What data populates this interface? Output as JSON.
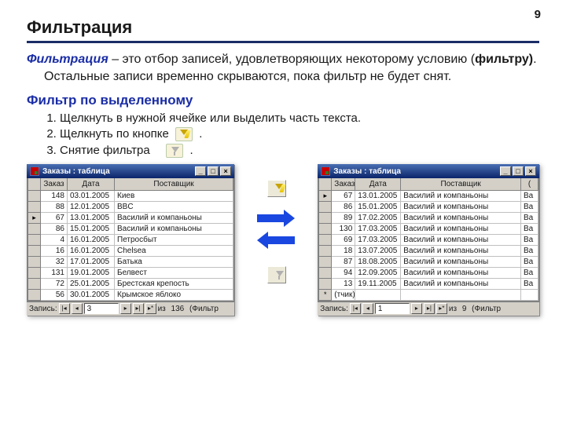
{
  "page_number": "9",
  "title": "Фильтрация",
  "definition": {
    "term": "Фильтрация",
    "dash_and_text": " – это отбор записей, удовлетворяющих некоторому условию (",
    "bold_word": "фильтру)",
    "after_bold": ".",
    "line2": "Остальные записи временно скрываются, пока фильтр не будет снят."
  },
  "selection_filter_title": "Фильтр по выделенному",
  "steps": [
    "Щелкнуть в нужной ячейке или выделить часть текста.",
    "Щелкнуть по кнопке",
    "Снятие фильтра"
  ],
  "trail_dot": ".",
  "icons": {
    "apply_filter": "filter-by-selection-icon",
    "remove_filter": "remove-filter-icon"
  },
  "window_title": "Заказы : таблица",
  "table_headers": {
    "id": "Заказ",
    "date": "Дата",
    "supplier": "Поставщик",
    "extra": "("
  },
  "record_label": "Запись:",
  "of_label": "из",
  "filter_suffix": "(Фильтр",
  "left_table": {
    "rows": [
      {
        "id": "148",
        "date": "03.01.2005",
        "supplier": "Киев"
      },
      {
        "id": "88",
        "date": "12.01.2005",
        "supplier": "BBC"
      },
      {
        "id": "67",
        "date": "13.01.2005",
        "supplier": "Василий и компаньоны",
        "marker": "▸"
      },
      {
        "id": "86",
        "date": "15.01.2005",
        "supplier": "Василий и компаньоны"
      },
      {
        "id": "4",
        "date": "16.01.2005",
        "supplier": "Петросбыт"
      },
      {
        "id": "16",
        "date": "16.01.2005",
        "supplier": "Chelsea"
      },
      {
        "id": "32",
        "date": "17.01.2005",
        "supplier": "Батька"
      },
      {
        "id": "131",
        "date": "19.01.2005",
        "supplier": "Белвест"
      },
      {
        "id": "72",
        "date": "25.01.2005",
        "supplier": "Брестская крепость"
      },
      {
        "id": "56",
        "date": "30.01.2005",
        "supplier": "Крымское яблоко"
      }
    ],
    "current": "3",
    "total": "136"
  },
  "right_table": {
    "rows": [
      {
        "id": "67",
        "date": "13.01.2005",
        "supplier": "Василий и компаньоны",
        "extra": "Ва",
        "marker": "▸"
      },
      {
        "id": "86",
        "date": "15.01.2005",
        "supplier": "Василий и компаньоны",
        "extra": "Ва"
      },
      {
        "id": "89",
        "date": "17.02.2005",
        "supplier": "Василий и компаньоны",
        "extra": "Ва"
      },
      {
        "id": "130",
        "date": "17.03.2005",
        "supplier": "Василий и компаньоны",
        "extra": "Ва"
      },
      {
        "id": "69",
        "date": "17.03.2005",
        "supplier": "Василий и компаньоны",
        "extra": "Ва"
      },
      {
        "id": "18",
        "date": "13.07.2005",
        "supplier": "Василий и компаньоны",
        "extra": "Ва"
      },
      {
        "id": "87",
        "date": "18.08.2005",
        "supplier": "Василий и компаньоны",
        "extra": "Ва"
      },
      {
        "id": "94",
        "date": "12.09.2005",
        "supplier": "Василий и компаньоны",
        "extra": "Ва"
      },
      {
        "id": "13",
        "date": "19.11.2005",
        "supplier": "Василий и компаньоны",
        "extra": "Ва"
      }
    ],
    "new_row_label": "(тчик)",
    "current": "1",
    "total": "9"
  }
}
